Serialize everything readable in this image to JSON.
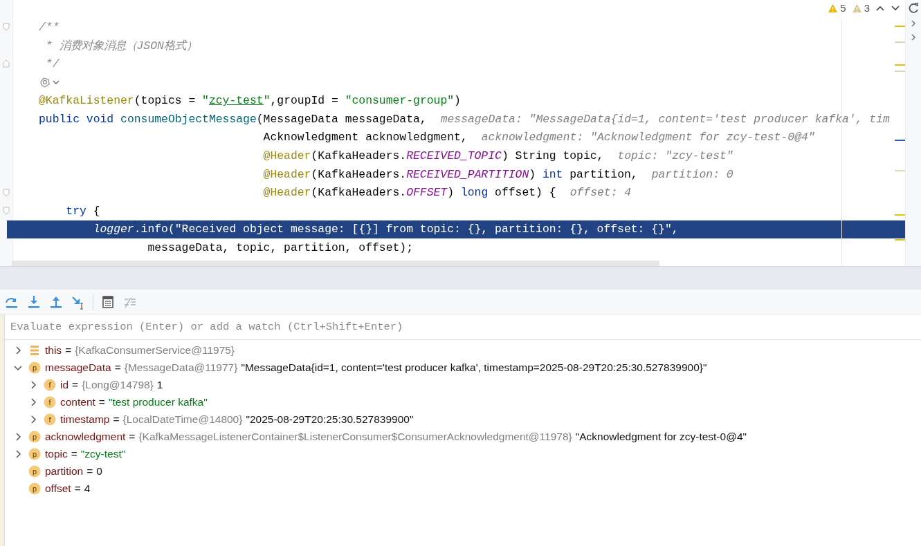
{
  "editor": {
    "problems": [
      {
        "kind": "warning",
        "count": "5"
      },
      {
        "kind": "weak_warning",
        "count": "3"
      }
    ],
    "lines": [
      {
        "kind": "code",
        "fold_start": true,
        "fold_end": false,
        "selected": false,
        "tokens": [
          {
            "kind": "comment",
            "text": "/**"
          }
        ]
      },
      {
        "kind": "code",
        "fold_start": false,
        "fold_end": false,
        "selected": false,
        "tokens": [
          {
            "kind": "comment",
            "text": " * 消费对象消息（JSON格式）"
          }
        ]
      },
      {
        "kind": "code",
        "fold_start": false,
        "fold_end": true,
        "selected": false,
        "tokens": [
          {
            "kind": "comment",
            "text": " */"
          }
        ]
      },
      {
        "kind": "inlay",
        "fold_start": false,
        "fold_end": false,
        "selected": false
      },
      {
        "kind": "code",
        "fold_start": false,
        "fold_end": false,
        "selected": false,
        "tokens": [
          {
            "kind": "annotation",
            "text": "@KafkaListener"
          },
          {
            "kind": "plain",
            "text": "(topics = "
          },
          {
            "kind": "string",
            "text": "\""
          },
          {
            "kind": "link",
            "text": "zcy-test"
          },
          {
            "kind": "string",
            "text": "\""
          },
          {
            "kind": "plain",
            "text": ",groupId = "
          },
          {
            "kind": "string",
            "text": "\"consumer-group\""
          },
          {
            "kind": "plain",
            "text": ")"
          }
        ]
      },
      {
        "kind": "code",
        "fold_start": false,
        "fold_end": false,
        "selected": false,
        "tokens": [
          {
            "kind": "keyword",
            "text": "public void "
          },
          {
            "kind": "method",
            "text": "consumeObjectMessage"
          },
          {
            "kind": "plain",
            "text": "(MessageData messageData,"
          }
        ],
        "hint": "messageData: \"MessageData{id=1, content='test producer kafka', tim"
      },
      {
        "kind": "code",
        "fold_start": false,
        "fold_end": false,
        "selected": false,
        "tokens": [
          {
            "kind": "plain",
            "text": "                                 Acknowledgment acknowledgment,"
          }
        ],
        "hint": "acknowledgment: \"Acknowledgment for zcy-test-0@4\""
      },
      {
        "kind": "code",
        "fold_start": false,
        "fold_end": false,
        "selected": false,
        "tokens": [
          {
            "kind": "annotation",
            "text": "                                 @Header"
          },
          {
            "kind": "plain",
            "text": "(KafkaHeaders."
          },
          {
            "kind": "constant",
            "text": "RECEIVED_TOPIC"
          },
          {
            "kind": "plain",
            "text": ") String topic,"
          }
        ],
        "hint": "topic: \"zcy-test\""
      },
      {
        "kind": "code",
        "fold_start": false,
        "fold_end": false,
        "selected": false,
        "tokens": [
          {
            "kind": "annotation",
            "text": "                                 @Header"
          },
          {
            "kind": "plain",
            "text": "(KafkaHeaders."
          },
          {
            "kind": "constant",
            "text": "RECEIVED_PARTITION"
          },
          {
            "kind": "plain",
            "text": ") "
          },
          {
            "kind": "keyword",
            "text": "int"
          },
          {
            "kind": "plain",
            "text": " partition,"
          }
        ],
        "hint": "partition: 0"
      },
      {
        "kind": "code",
        "fold_start": true,
        "fold_end": false,
        "selected": false,
        "tokens": [
          {
            "kind": "annotation",
            "text": "                                 @Header"
          },
          {
            "kind": "plain",
            "text": "(KafkaHeaders."
          },
          {
            "kind": "constant",
            "text": "OFFSET"
          },
          {
            "kind": "plain",
            "text": ") "
          },
          {
            "kind": "keyword",
            "text": "long"
          },
          {
            "kind": "plain",
            "text": " offset) {"
          }
        ],
        "hint": "offset: 4"
      },
      {
        "kind": "code",
        "fold_start": true,
        "fold_end": false,
        "selected": false,
        "tokens": [
          {
            "kind": "keyword",
            "text": "    try"
          },
          {
            "kind": "plain",
            "text": " {"
          }
        ]
      },
      {
        "kind": "code",
        "fold_start": false,
        "fold_end": false,
        "selected": true,
        "tokens": [
          {
            "kind": "constant",
            "text": "        logger"
          },
          {
            "kind": "plain",
            "text": ".info("
          },
          {
            "kind": "string",
            "text": "\"Received object message: [{}] from topic: {}, partition: {}, offset: {}\""
          },
          {
            "kind": "plain",
            "text": ","
          }
        ]
      },
      {
        "kind": "code",
        "fold_start": false,
        "fold_end": false,
        "selected": false,
        "tokens": [
          {
            "kind": "plain",
            "text": "                messageData, topic, partition, offset);"
          }
        ]
      }
    ]
  },
  "debugger": {
    "toolbar": [
      {
        "kind": "step_over",
        "disabled": false
      },
      {
        "kind": "step_into",
        "disabled": false
      },
      {
        "kind": "step_out",
        "disabled": false
      },
      {
        "kind": "run_to_cursor",
        "disabled": false
      },
      {
        "kind": "evaluate",
        "disabled": false
      },
      {
        "kind": "trace",
        "disabled": true
      }
    ],
    "watch_field": {
      "placeholder": "Evaluate expression (Enter) or add a watch (Ctrl+Shift+Enter)"
    },
    "variables": [
      {
        "kind": "object",
        "name": "this",
        "operator": "=",
        "type": "{KafkaConsumerService@11975}",
        "expandable": true,
        "expanded": false
      },
      {
        "kind": "param",
        "badge": "p",
        "name": "messageData",
        "operator": "=",
        "type": "{MessageData@11977}",
        "value": "\"MessageData{id=1, content='test producer kafka', timestamp=2025-08-29T20:25:30.527839900}\"",
        "string_value": false,
        "expandable": true,
        "expanded": true,
        "children": [
          {
            "kind": "field",
            "badge": "f",
            "name": "id",
            "operator": "=",
            "type": "{Long@14798}",
            "value": "1",
            "string_value": false,
            "expandable": true,
            "expanded": false
          },
          {
            "kind": "field",
            "badge": "f",
            "name": "content",
            "operator": "=",
            "value": "\"test producer kafka\"",
            "string_value": true,
            "expandable": true,
            "expanded": false
          },
          {
            "kind": "field",
            "badge": "f",
            "name": "timestamp",
            "operator": "=",
            "type": "{LocalDateTime@14800}",
            "value": "\"2025-08-29T20:25:30.527839900\"",
            "string_value": false,
            "expandable": true,
            "expanded": false
          }
        ]
      },
      {
        "kind": "param",
        "badge": "p",
        "name": "acknowledgment",
        "operator": "=",
        "type": "{KafkaMessageListenerContainer$ListenerConsumer$ConsumerAcknowledgment@11978}",
        "value": "\"Acknowledgment for zcy-test-0@4\"",
        "string_value": false,
        "expandable": true,
        "expanded": false
      },
      {
        "kind": "param",
        "badge": "p",
        "name": "topic",
        "operator": "=",
        "value": "\"zcy-test\"",
        "string_value": true,
        "expandable": true,
        "expanded": false
      },
      {
        "kind": "param",
        "badge": "p",
        "name": "partition",
        "operator": "=",
        "value": "0",
        "string_value": false,
        "expandable": false
      },
      {
        "kind": "param",
        "badge": "p",
        "name": "offset",
        "operator": "=",
        "value": "4",
        "string_value": false,
        "expandable": false
      }
    ]
  }
}
